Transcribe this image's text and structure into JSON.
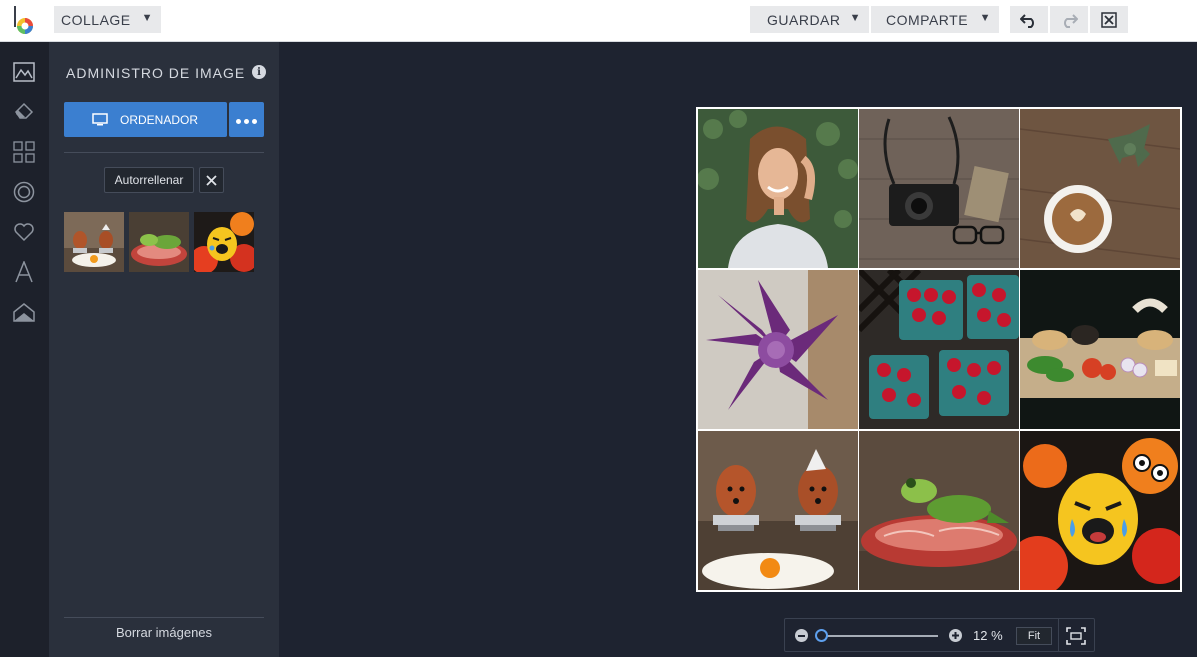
{
  "topbar": {
    "mode_label": "COLLAGE",
    "save_label": "GUARDAR",
    "share_label": "COMPARTE",
    "caret": "▼",
    "undo_icon": "undo-icon",
    "redo_icon": "redo-icon",
    "close_icon": "close-icon"
  },
  "rail": {
    "items": [
      "image-manager-icon",
      "eraser-icon",
      "layout-grid-icon",
      "circle-target-icon",
      "heart-icon",
      "text-icon",
      "background-icon"
    ]
  },
  "panel": {
    "title": "ADMINISTRO DE IMAGE",
    "info": "i",
    "ordenador_label": "ORDENADOR",
    "autofill_label": "Autorrellenar",
    "delete_label": "Borrar imágenes",
    "thumbnails": [
      "eggs-thumbnail",
      "frog-thumbnail",
      "crying-egg-thumbnail"
    ]
  },
  "canvas": {
    "cells": [
      "woman-smiling",
      "camera-and-glasses",
      "coffee-and-succulent",
      "purple-succulent",
      "raspberries",
      "sandwich-ingredients",
      "eggs-with-faces",
      "frog-on-ham",
      "crying-eggs"
    ]
  },
  "zoom": {
    "value_label": "12 %",
    "fit_label": "Fit",
    "level": 0.0
  },
  "colors": {
    "accent": "#3b7fd0",
    "panel": "#2a303c",
    "canvas": "#1e2330",
    "rail": "#1d212b"
  }
}
